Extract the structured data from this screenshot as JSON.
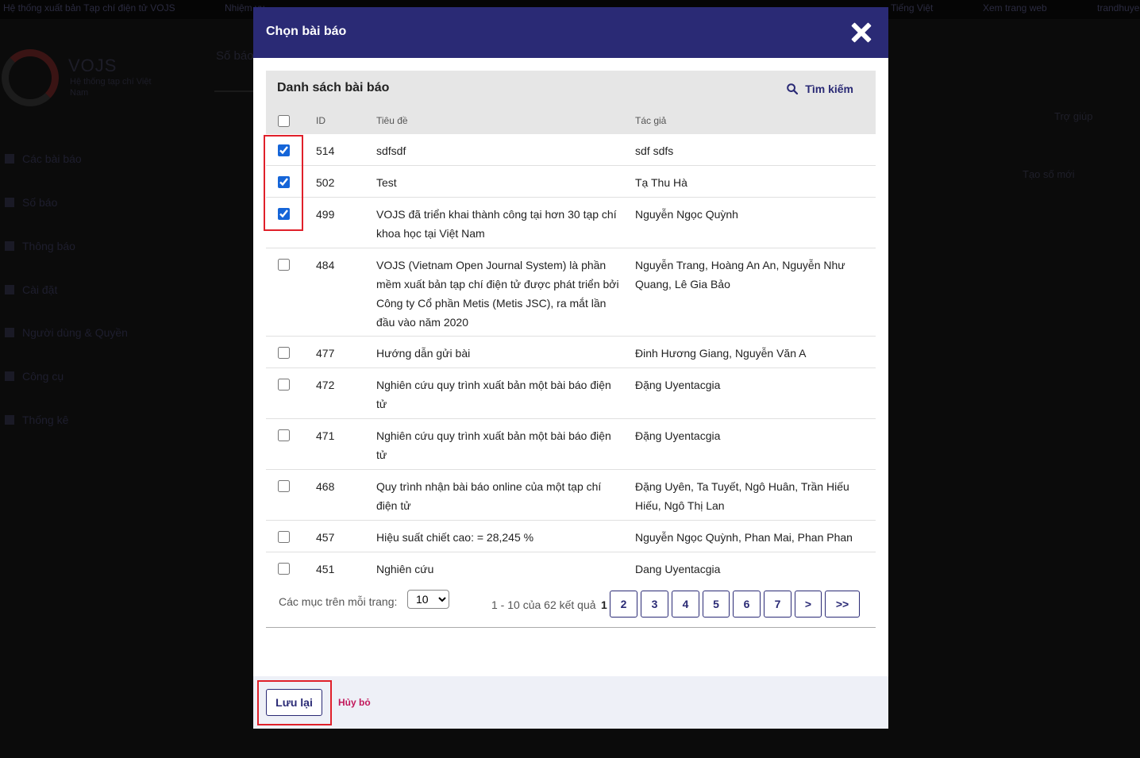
{
  "background": {
    "topbar_left": "Hệ thống xuất bản Tạp chí điện tử VOJS",
    "topbar_item": "Nhiệm vụ",
    "topbar_lang": "Tiếng Việt",
    "topbar_view": "Xem trang web",
    "topbar_user": "trandhuyen",
    "brand": "VOJS",
    "brand_sub": "Hệ thống tạp chí Việt Nam",
    "section_title": "Số báo",
    "help": "Trợ giúp",
    "create_issue": "Tạo số mới",
    "nav": [
      "Các bài báo",
      "Số báo",
      "Thông báo",
      "Cài đặt",
      "Người dùng & Quyền",
      "Công cụ",
      "Thống kê"
    ]
  },
  "modal": {
    "title": "Chọn bài báo",
    "list_title": "Danh sách bài báo",
    "search_label": "Tìm kiếm",
    "columns": {
      "id": "ID",
      "title": "Tiêu đề",
      "author": "Tác giả"
    },
    "rows": [
      {
        "id": "514",
        "title": "sdfsdf",
        "author": "sdf sdfs",
        "checked": true
      },
      {
        "id": "502",
        "title": "Test",
        "author": "Tạ Thu Hà",
        "checked": true
      },
      {
        "id": "499",
        "title": "VOJS đã triển khai thành công tại hơn 30 tạp chí khoa học tại Việt Nam",
        "author": "Nguyễn Ngọc Quỳnh",
        "checked": true
      },
      {
        "id": "484",
        "title": "VOJS (Vietnam Open Journal System) là phần mềm xuất bản tạp chí điện tử được phát triển bởi Công ty Cổ phần Metis (Metis JSC), ra mắt lần đầu vào năm 2020",
        "author": "Nguyễn Trang, Hoàng An An, Nguyễn Như Quang, Lê Gia Bảo",
        "checked": false
      },
      {
        "id": "477",
        "title": "Hướng dẫn gửi bài",
        "author": "Đinh Hương Giang, Nguyễn Văn A",
        "checked": false
      },
      {
        "id": "472",
        "title": "Nghiên cứu quy trình xuất bản một bài báo điện tử",
        "author": "Đặng Uyentacgia",
        "checked": false
      },
      {
        "id": "471",
        "title": "Nghiên cứu quy trình xuất bản một bài báo điện tử",
        "author": "Đặng Uyentacgia",
        "checked": false
      },
      {
        "id": "468",
        "title": "Quy trình nhận bài báo online của một tạp chí điện tử",
        "author": "Đặng Uyên, Ta Tuyết, Ngô Huân, Trần Hiếu Hiếu, Ngô Thị Lan",
        "checked": false
      },
      {
        "id": "457",
        "title": "Hiệu suất chiết cao: = 28,245 %",
        "author": "Nguyễn Ngọc Quỳnh, Phan Mai, Phan Phan",
        "checked": false
      },
      {
        "id": "451",
        "title": "Nghiên cứu",
        "author": "Dang Uyentacgia",
        "checked": false
      }
    ],
    "pagination": {
      "per_page_label": "Các mục trên mỗi trang:",
      "per_page_value": "10",
      "info": "1 - 10 của 62 kết quả",
      "current_page": "1",
      "pages": [
        "2",
        "3",
        "4",
        "5",
        "6",
        "7",
        ">",
        ">>"
      ]
    },
    "save_label": "Lưu lại",
    "cancel_label": "Hủy bỏ"
  },
  "colors": {
    "header_bg": "#2a2a75",
    "checkbox_checked": "#1565d8",
    "cancel_link": "#c2185b",
    "highlight": "#e0202a"
  }
}
